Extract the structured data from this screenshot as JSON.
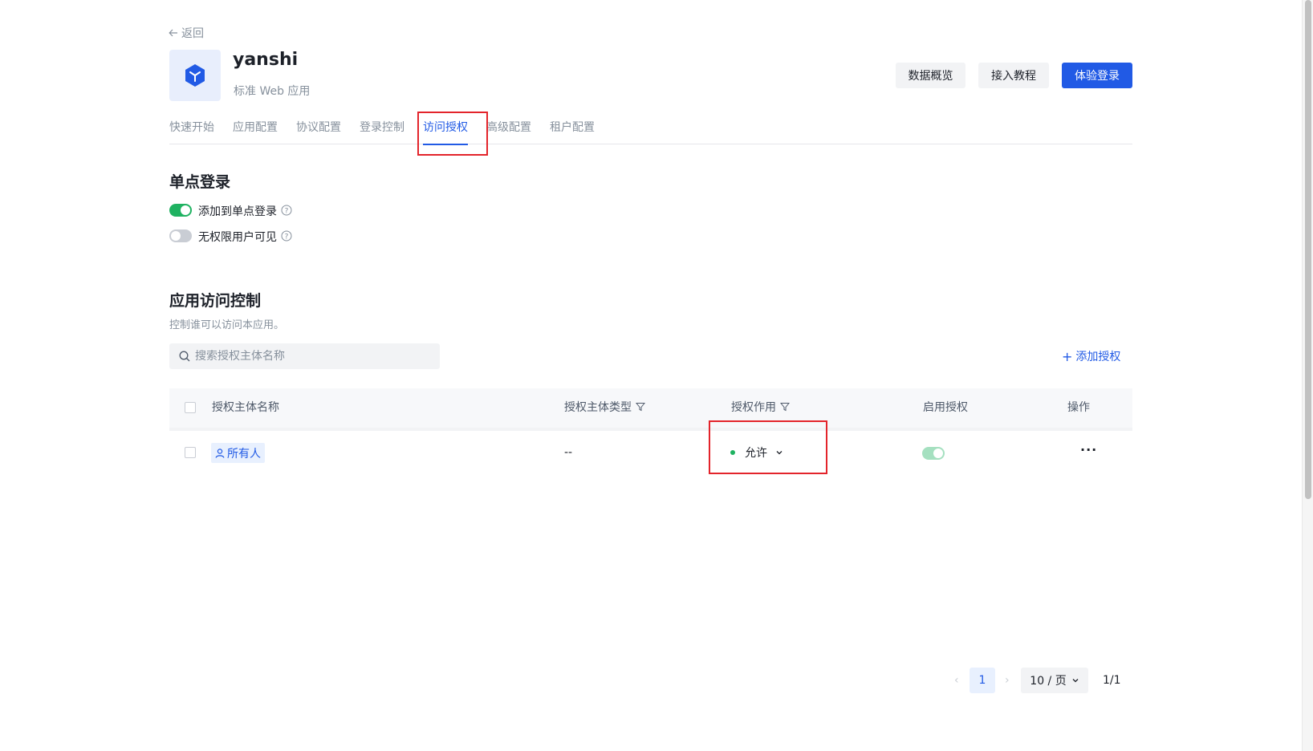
{
  "nav": {
    "back_label": "返回"
  },
  "app": {
    "name": "yanshi",
    "type": "标准 Web 应用"
  },
  "header_buttons": {
    "overview": "数据概览",
    "tutorial": "接入教程",
    "try_login": "体验登录"
  },
  "tabs": [
    {
      "label": "快速开始",
      "active": false
    },
    {
      "label": "应用配置",
      "active": false
    },
    {
      "label": "协议配置",
      "active": false
    },
    {
      "label": "登录控制",
      "active": false
    },
    {
      "label": "访问授权",
      "active": true
    },
    {
      "label": "高级配置",
      "active": false
    },
    {
      "label": "租户配置",
      "active": false
    }
  ],
  "sso": {
    "title": "单点登录",
    "options": [
      {
        "label": "添加到单点登录",
        "enabled": true
      },
      {
        "label": "无权限用户可见",
        "enabled": false
      }
    ]
  },
  "access": {
    "title": "应用访问控制",
    "description": "控制谁可以访问本应用。",
    "search_placeholder": "搜索授权主体名称",
    "add_label": "添加授权",
    "columns": {
      "name": "授权主体名称",
      "type": "授权主体类型",
      "effect": "授权作用",
      "enabled": "启用授权",
      "actions": "操作"
    },
    "rows": [
      {
        "name": "所有人",
        "type": "--",
        "effect": "允许",
        "enabled": true,
        "actions": "···"
      }
    ]
  },
  "pagination": {
    "current": "1",
    "page_size": "10 / 页",
    "total": "1/1"
  },
  "colors": {
    "primary": "#215ae5",
    "success": "#1fb261",
    "highlight": "#e3242b"
  }
}
